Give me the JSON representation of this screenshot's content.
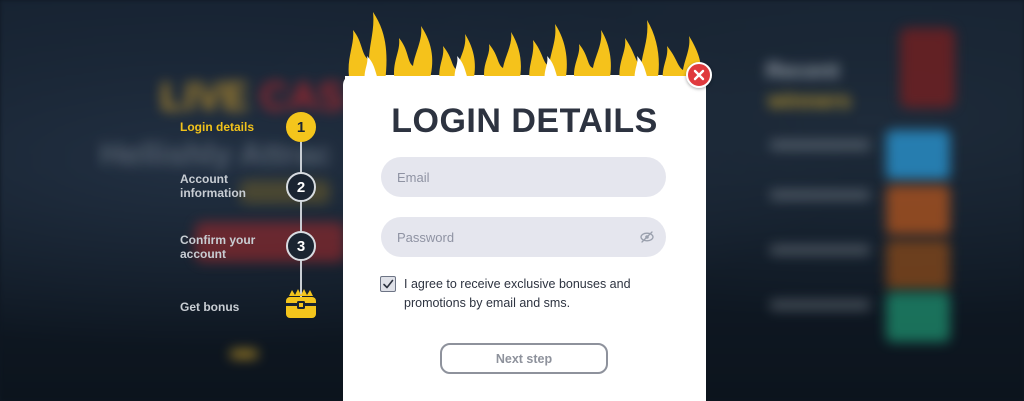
{
  "background": {
    "headline_part1": "LIVE",
    "headline_part2": "CAS",
    "tagline": "Hellishly Attrac",
    "recent": "Recent",
    "winners": "winners"
  },
  "stepper": {
    "steps": [
      {
        "label": "Login details",
        "number": "1",
        "state": "active"
      },
      {
        "label": "Account\ninformation",
        "number": "2",
        "state": "pending"
      },
      {
        "label": "Confirm your\naccount",
        "number": "3",
        "state": "pending"
      },
      {
        "label": "Get bonus",
        "icon": "treasure-chest-icon",
        "state": "pending"
      }
    ]
  },
  "modal": {
    "title": "LOGIN DETAILS",
    "email_placeholder": "Email",
    "email_value": "",
    "password_placeholder": "Password",
    "password_value": "",
    "consent_checked": true,
    "consent_text": "I agree to receive exclusive bonuses and promotions by email and sms.",
    "next_label": "Next step",
    "close_icon": "close-icon",
    "eye_icon": "eye-off-icon",
    "flame_icon": "flames-decoration"
  },
  "colors": {
    "accent": "#f4c51c",
    "close": "#e03a3e",
    "title": "#2d3340",
    "field_bg": "#e5e6ee"
  }
}
